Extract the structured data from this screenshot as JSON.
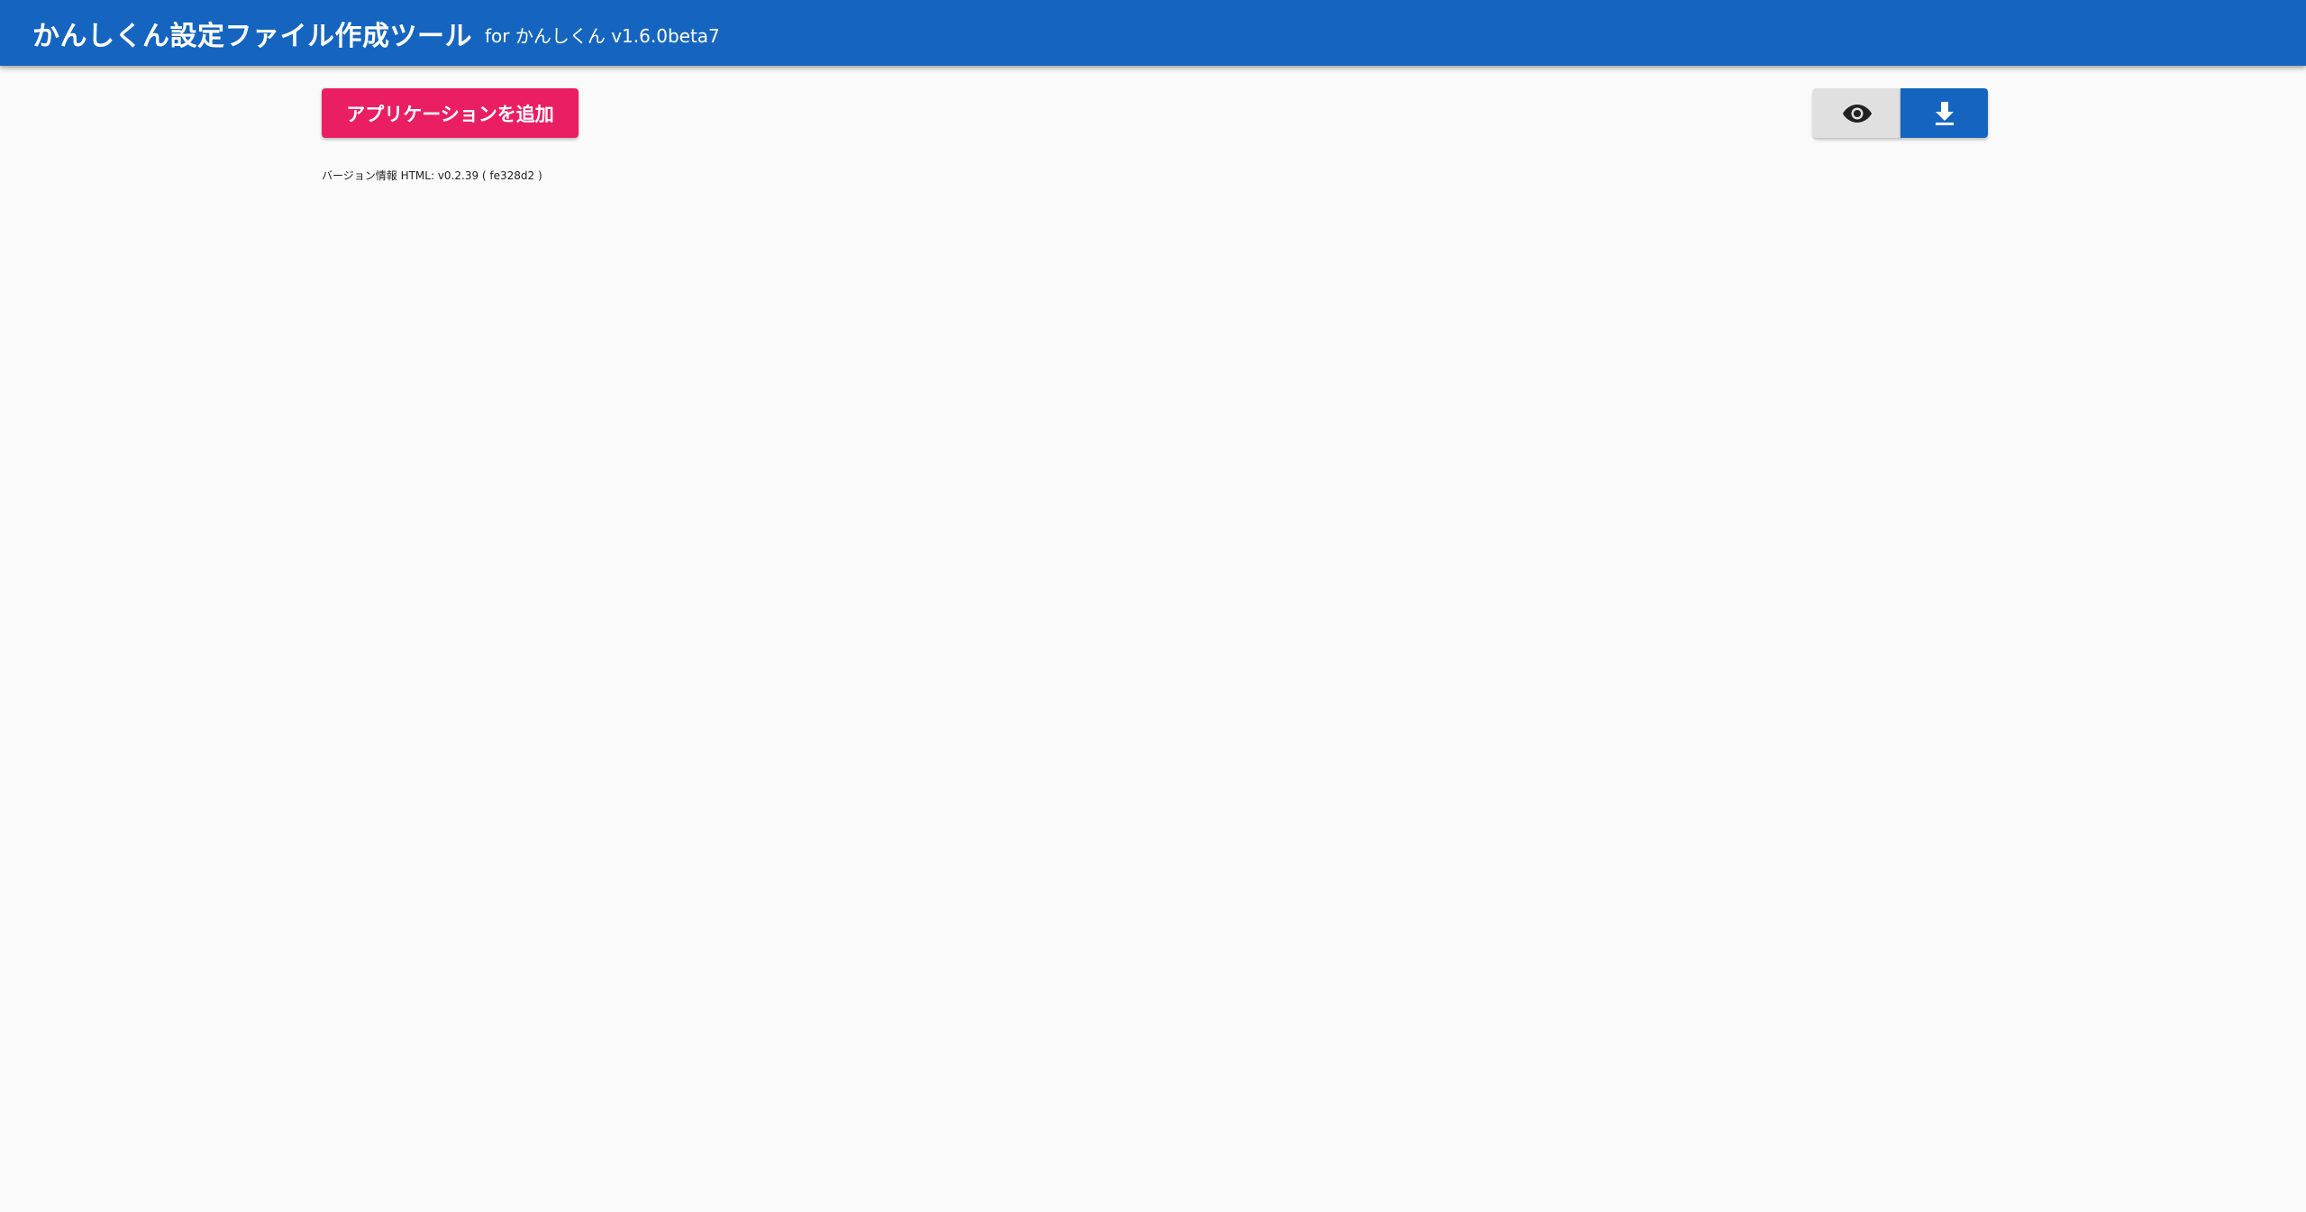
{
  "header": {
    "title": "かんしくん設定ファイル作成ツール",
    "subtitle": "for かんしくん v1.6.0beta7",
    "background_color": "#1565c0"
  },
  "toolbar": {
    "add_application_label": "アプリケーションを追加",
    "add_application_color": "#e91e63",
    "preview_icon": "eye-icon",
    "download_icon": "download-icon"
  },
  "version_info": {
    "label": "バージョン情報",
    "html_prefix": "HTML:",
    "version": "v0.2.39",
    "commit": "( fe328d2 )"
  }
}
